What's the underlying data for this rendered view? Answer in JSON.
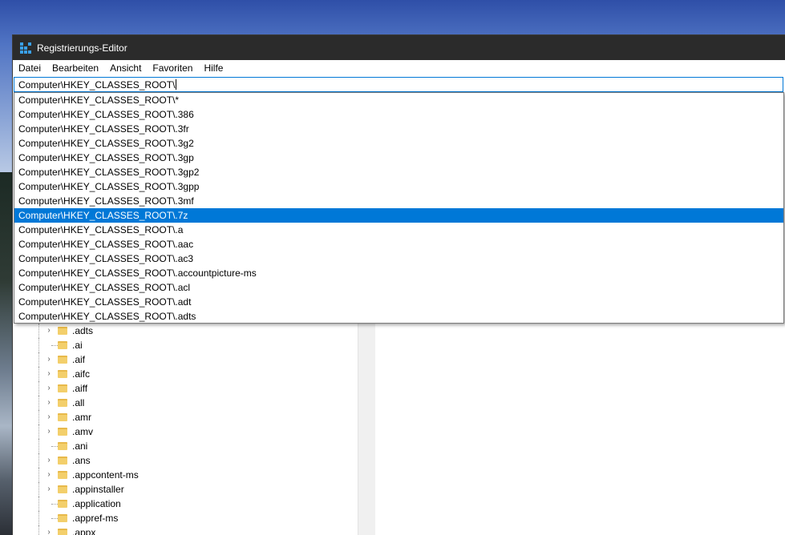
{
  "window": {
    "title": "Registrierungs-Editor"
  },
  "menu": [
    "Datei",
    "Bearbeiten",
    "Ansicht",
    "Favoriten",
    "Hilfe"
  ],
  "address": {
    "value": "Computer\\HKEY_CLASSES_ROOT\\"
  },
  "suggestions": {
    "selected_index": 8,
    "items": [
      "Computer\\HKEY_CLASSES_ROOT\\*",
      "Computer\\HKEY_CLASSES_ROOT\\.386",
      "Computer\\HKEY_CLASSES_ROOT\\.3fr",
      "Computer\\HKEY_CLASSES_ROOT\\.3g2",
      "Computer\\HKEY_CLASSES_ROOT\\.3gp",
      "Computer\\HKEY_CLASSES_ROOT\\.3gp2",
      "Computer\\HKEY_CLASSES_ROOT\\.3gpp",
      "Computer\\HKEY_CLASSES_ROOT\\.3mf",
      "Computer\\HKEY_CLASSES_ROOT\\.7z",
      "Computer\\HKEY_CLASSES_ROOT\\.a",
      "Computer\\HKEY_CLASSES_ROOT\\.aac",
      "Computer\\HKEY_CLASSES_ROOT\\.ac3",
      "Computer\\HKEY_CLASSES_ROOT\\.accountpicture-ms",
      "Computer\\HKEY_CLASSES_ROOT\\.acl",
      "Computer\\HKEY_CLASSES_ROOT\\.adt",
      "Computer\\HKEY_CLASSES_ROOT\\.adts"
    ]
  },
  "tree": {
    "items": [
      {
        "label": ".adts",
        "expandable": true
      },
      {
        "label": ".ai",
        "expandable": false
      },
      {
        "label": ".aif",
        "expandable": true
      },
      {
        "label": ".aifc",
        "expandable": true
      },
      {
        "label": ".aiff",
        "expandable": true
      },
      {
        "label": ".all",
        "expandable": true
      },
      {
        "label": ".amr",
        "expandable": true
      },
      {
        "label": ".amv",
        "expandable": true
      },
      {
        "label": ".ani",
        "expandable": false
      },
      {
        "label": ".ans",
        "expandable": true
      },
      {
        "label": ".appcontent-ms",
        "expandable": true
      },
      {
        "label": ".appinstaller",
        "expandable": true
      },
      {
        "label": ".application",
        "expandable": false
      },
      {
        "label": ".appref-ms",
        "expandable": false
      },
      {
        "label": ".appx",
        "expandable": true
      }
    ]
  },
  "icons": {
    "app": "registry-editor-icon",
    "folder": "folder-icon",
    "expand": "chevron-right-icon"
  },
  "colors": {
    "selection": "#0078d7",
    "titlebar": "#2b2b2b",
    "folder": "#f3cf6b"
  }
}
